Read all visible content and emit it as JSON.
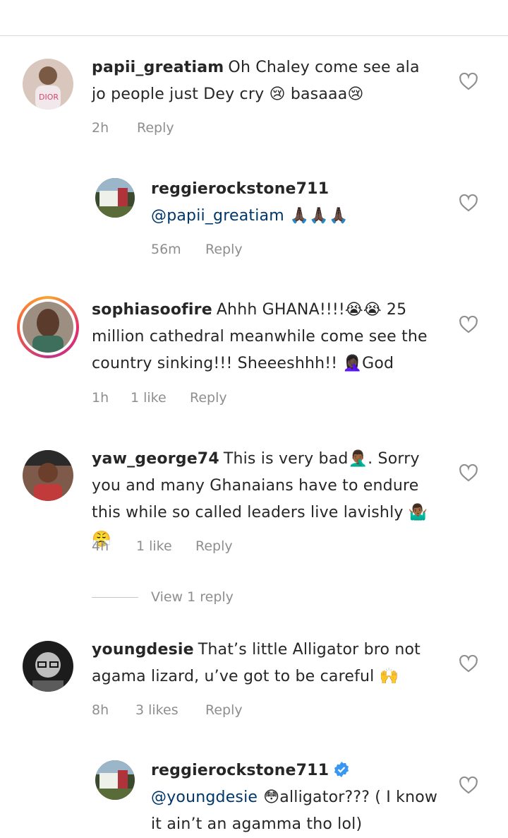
{
  "comments": [
    {
      "username": "papii_greatiam",
      "text": "Oh Chaley come see ala jo people just Dey cry 😢 basaaa😢",
      "time": "2h",
      "reply_label": "Reply"
    },
    {
      "username": "reggierockstone711",
      "mention": "@papii_greatiam",
      "text": "🙏🏿🙏🏿🙏🏿",
      "time": "56m",
      "reply_label": "Reply"
    },
    {
      "username": "sophiasoofire",
      "text": "Ahhh GHANA!!!!😭😭 25 million cathedral meanwhile come see the country sinking!!! Sheeeshhh!! 🤦🏿‍♀️God",
      "time": "1h",
      "likes": "1 like",
      "reply_label": "Reply"
    },
    {
      "username": "yaw_george74",
      "text": "This is very bad🤦🏾‍♂️. Sorry you and many Ghanaians have to endure this while so called leaders live lavishly 🤷🏾‍♂️😤",
      "time": "4h",
      "likes": "1 like",
      "reply_label": "Reply",
      "view_replies": "View 1 reply"
    },
    {
      "username": "youngdesie",
      "text": "That’s little Alligator bro not agama lizard, u’ve got to be careful 🙌",
      "time": "8h",
      "likes": "3 likes",
      "reply_label": "Reply"
    },
    {
      "username": "reggierockstone711",
      "mention": "@youngdesie",
      "text": "😳alligator??? ( I know it ain’t an agamma tho lol)",
      "verified": true
    }
  ],
  "colors": {
    "mention": "#00376b",
    "meta": "#8e8e8e",
    "verified": "#3897f0"
  },
  "icons": {
    "like": "heart-outline-icon",
    "verified": "verified-badge-icon"
  }
}
